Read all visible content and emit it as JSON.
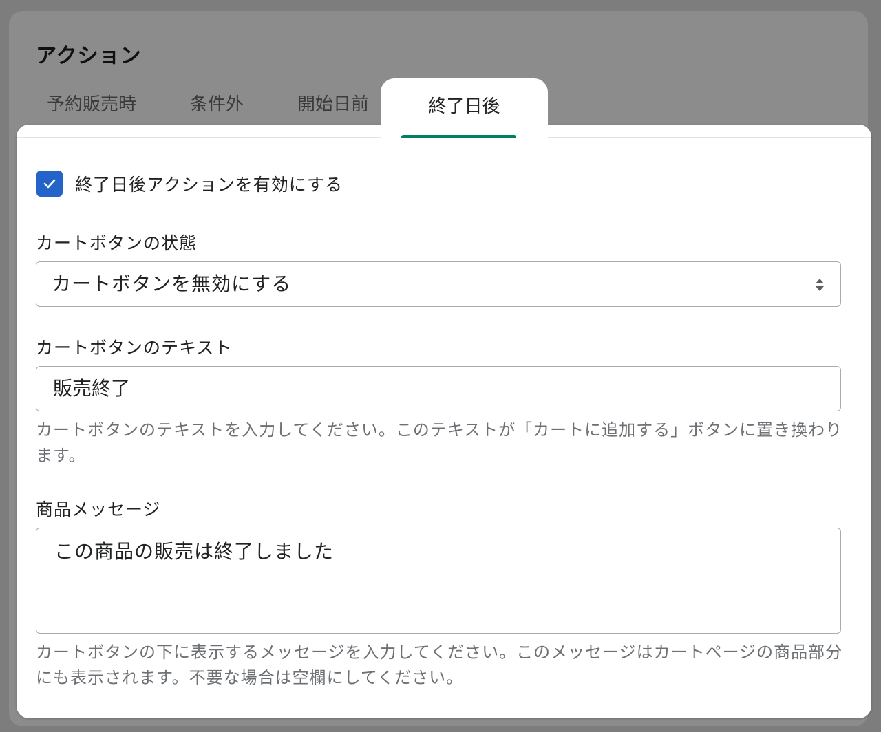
{
  "section": {
    "title": "アクション"
  },
  "tabs": [
    {
      "label": "予約販売時"
    },
    {
      "label": "条件外"
    },
    {
      "label": "開始日前"
    },
    {
      "label": "終了日後"
    }
  ],
  "active_tab": "終了日後",
  "enable_checkbox": {
    "label": "終了日後アクションを有効にする",
    "checked": true
  },
  "cart_button_state": {
    "label": "カートボタンの状態",
    "selected": "カートボタンを無効にする"
  },
  "cart_button_text": {
    "label": "カートボタンのテキスト",
    "value": "販売終了",
    "help": "カートボタンのテキストを入力してください。このテキストが「カートに追加する」ボタンに置き換わります。"
  },
  "product_message": {
    "label": "商品メッセージ",
    "value": "この商品の販売は終了しました",
    "help": "カートボタンの下に表示するメッセージを入力してください。このメッセージはカートページの商品部分にも表示されます。不要な場合は空欄にしてください。"
  },
  "colors": {
    "accent": "#008060",
    "checkbox": "#2463c7",
    "overlay": "#8c8c8c"
  }
}
